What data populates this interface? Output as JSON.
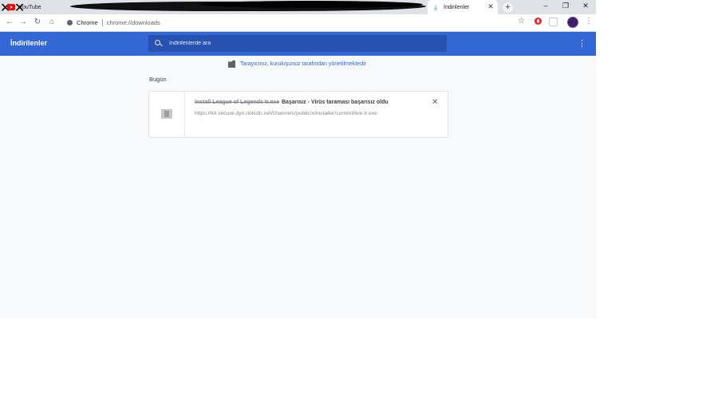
{
  "tabs": [
    {
      "title": "YouTube",
      "icon": "youtube-icon"
    },
    {
      "title": "İndirilenler",
      "icon": "download-icon",
      "active": true
    }
  ],
  "omnibox": {
    "site_label": "Chrome",
    "url": "chrome://downloads"
  },
  "header": {
    "title": "İndirilenler",
    "search_placeholder": "İndirilenlerde ara"
  },
  "managed_notice": "Tarayıcınız, kuruluşunuz tarafından yönetilmektedir",
  "section_date": "Bugün",
  "download": {
    "file_name": "Install League of Legends tr.exe",
    "status": "Başarısız - Virüs taraması başarısız oldu",
    "url": "https://lol.secure.dyn.riotcdn.net/channels/public/x/installer/current/live.tr.exe"
  },
  "colors": {
    "accent": "#3367d6",
    "search_bg": "#2752b4",
    "page_bg": "#f8f9fa"
  }
}
